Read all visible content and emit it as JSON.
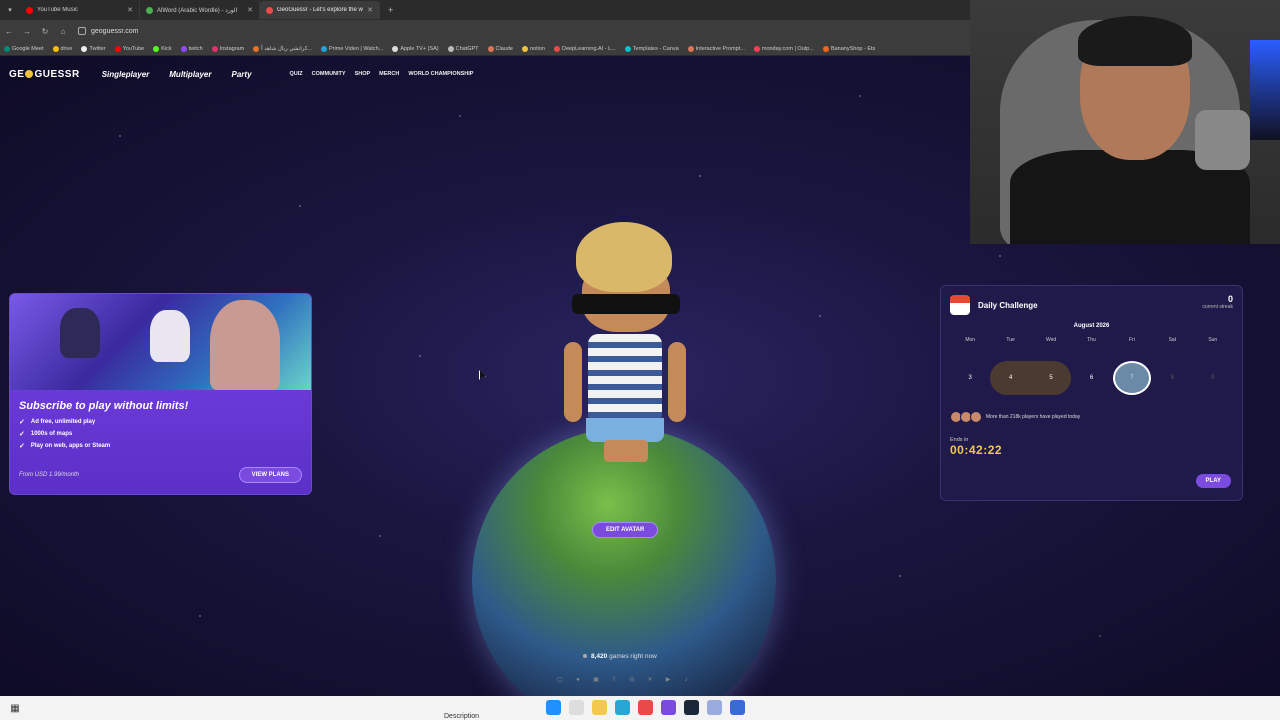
{
  "browser": {
    "tabs": [
      {
        "title": "YouTube Music",
        "color": "#ff0000",
        "active": false
      },
      {
        "title": "AlWord (Arabic Wordle) - الورد",
        "color": "#4caf50",
        "active": false
      },
      {
        "title": "GeoGuessr - Let's explore the w",
        "color": "#e84a4a",
        "active": true
      }
    ],
    "new_tab": "+",
    "url": "geoguessr.com",
    "bookmarks": [
      "Google Meet",
      "drive",
      "Twitter",
      "YouTube",
      "Kick",
      "twitch",
      "Instagram",
      "كراتشي ريال شاهد أ...",
      "Prime Video | Watch...",
      "Apple TV+ (SA)",
      "ChatGPT",
      "Claude",
      "notion",
      "DeepLearning.AI - L...",
      "Templates - Canva",
      "Interactive Prompt...",
      "monday.com | Outp...",
      "BananyShop - Ets"
    ]
  },
  "nav": {
    "logo_pre": "GE",
    "logo_post": "GUESSR",
    "main": [
      "Singleplayer",
      "Multiplayer",
      "Party"
    ],
    "small": [
      "QUIZ",
      "COMMUNITY",
      "SHOP",
      "MERCH",
      "WORLD CHAMPIONSHIP"
    ]
  },
  "subscribe": {
    "title": "Subscribe to play without limits!",
    "features": [
      "Ad free, unlimited play",
      "1000s of maps",
      "Play on web, apps or Steam"
    ],
    "price": "From USD 1.99/month",
    "button": "VIEW PLANS"
  },
  "avatar": {
    "edit_button": "EDIT AVATAR",
    "games_count": "8,420",
    "games_suffix": "games right now"
  },
  "daily": {
    "title": "Daily Challenge",
    "streak": "0",
    "streak_label": "current streak",
    "month": "August 2026",
    "days": [
      "Mon",
      "Tue",
      "Wed",
      "Thu",
      "Fri",
      "Sat",
      "Sun"
    ],
    "dates": [
      "3",
      "4",
      "5",
      "6",
      "7",
      "8",
      "9"
    ],
    "played_info": "More than 218k players have played today",
    "ends_label": "Ends in",
    "timer": "00:42:22",
    "play_button": "PLAY"
  },
  "taskbar": {
    "description": "Description"
  }
}
